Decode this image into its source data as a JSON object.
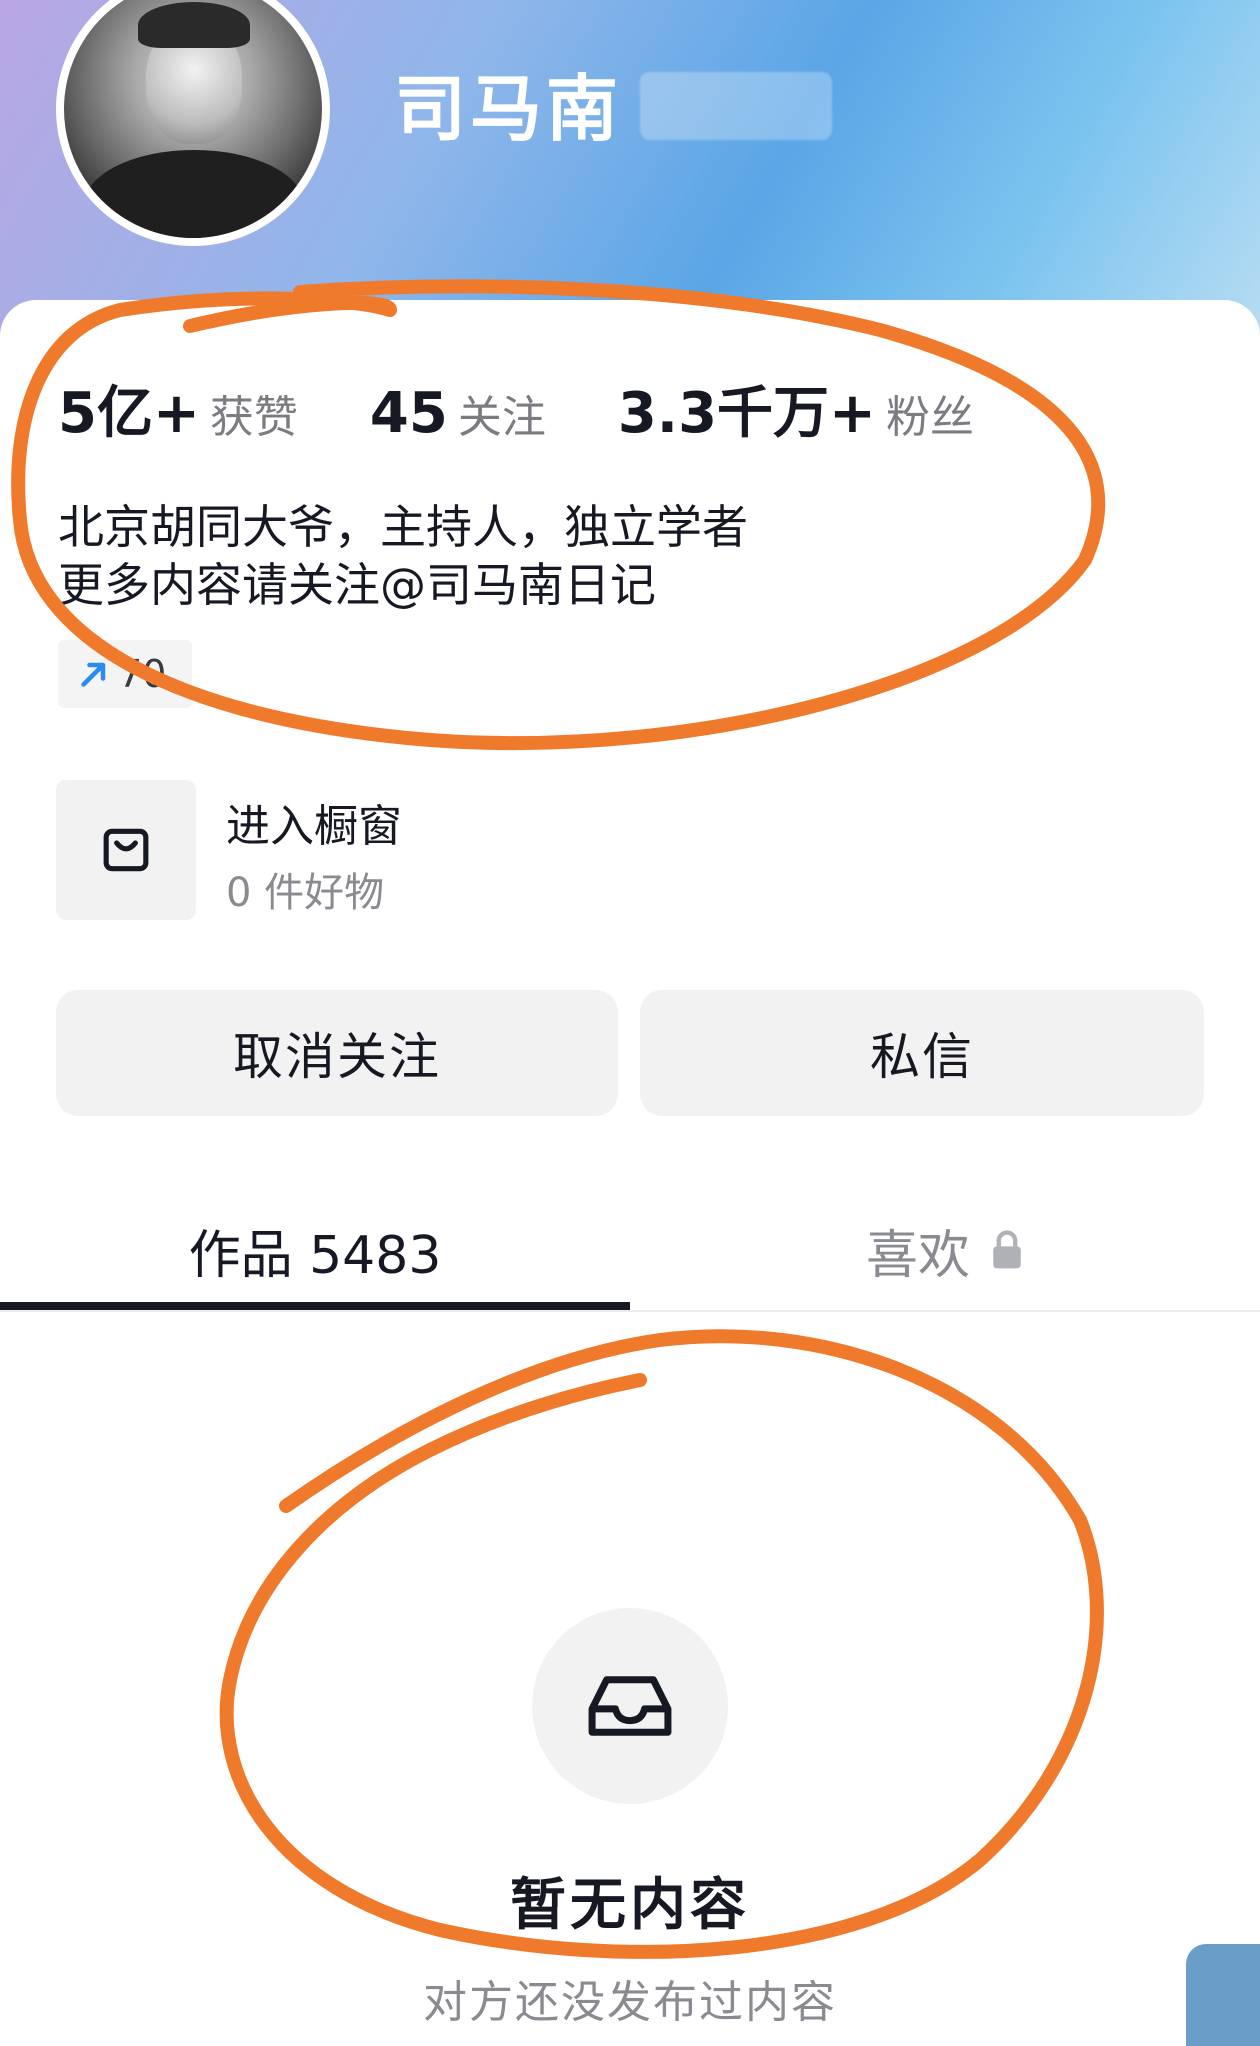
{
  "profile": {
    "username": "司马南",
    "avatar": "avatar-photo"
  },
  "stats": [
    {
      "value": "5亿+",
      "label": "获赞"
    },
    {
      "value": "45",
      "label": "关注"
    },
    {
      "value": "3.3千万+",
      "label": "粉丝"
    }
  ],
  "bio": {
    "line1": "北京胡同大爷，主持人，独立学者",
    "line2": "更多内容请关注@司马南日记"
  },
  "share": {
    "icon": "share-icon",
    "count": "70"
  },
  "shop": {
    "icon": "shopping-bag-icon",
    "title": "进入橱窗",
    "subtitle": "0 件好物"
  },
  "actions": {
    "unfollow_label": "取消关注",
    "message_label": "私信"
  },
  "tabs": [
    {
      "label": "作品 5483",
      "active": true
    },
    {
      "label": "喜欢",
      "icon": "lock-icon",
      "active": false
    }
  ],
  "empty_state": {
    "icon": "inbox-icon",
    "title": "暂无内容",
    "subtitle": "对方还没发布过内容"
  },
  "colors": {
    "annotation": "#f07a2c",
    "text_primary": "#161823",
    "text_secondary": "#8a8b91"
  }
}
